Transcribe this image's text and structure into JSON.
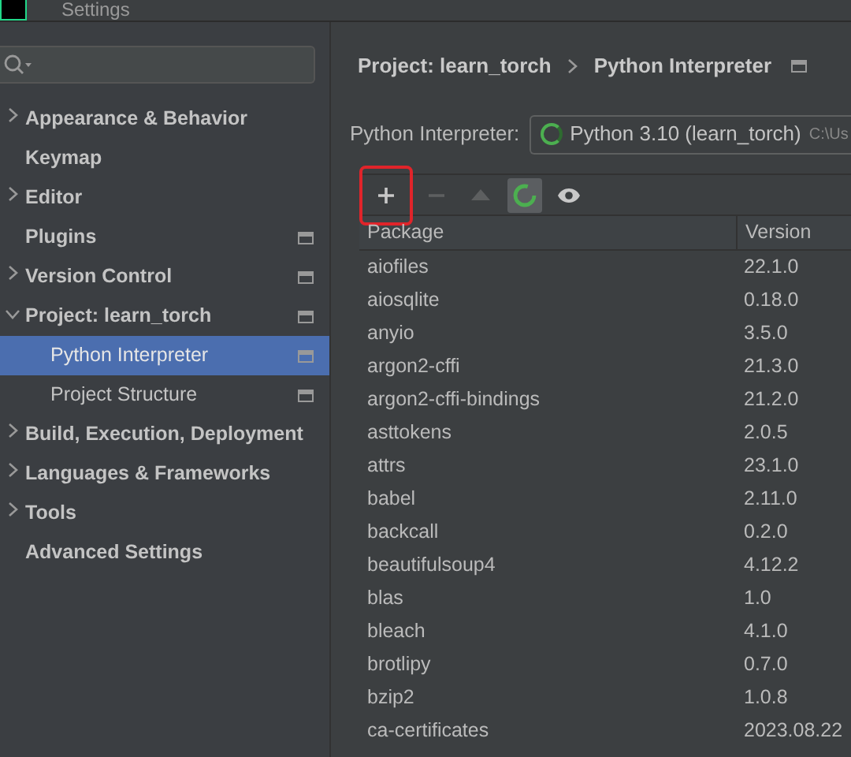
{
  "window": {
    "title": "Settings"
  },
  "sidebar": {
    "items": [
      {
        "label": "Appearance & Behavior",
        "expandable": true,
        "expanded": false,
        "project_mark": false,
        "selected": false
      },
      {
        "label": "Keymap",
        "expandable": false,
        "project_mark": false,
        "selected": false
      },
      {
        "label": "Editor",
        "expandable": true,
        "expanded": false,
        "project_mark": false,
        "selected": false
      },
      {
        "label": "Plugins",
        "expandable": false,
        "project_mark": true,
        "selected": false
      },
      {
        "label": "Version Control",
        "expandable": true,
        "expanded": false,
        "project_mark": true,
        "selected": false
      },
      {
        "label": "Project: learn_torch",
        "expandable": true,
        "expanded": true,
        "project_mark": true,
        "selected": false,
        "children": [
          {
            "label": "Python Interpreter",
            "project_mark": true,
            "selected": true
          },
          {
            "label": "Project Structure",
            "project_mark": true,
            "selected": false
          }
        ]
      },
      {
        "label": "Build, Execution, Deployment",
        "expandable": true,
        "expanded": false,
        "project_mark": false,
        "selected": false
      },
      {
        "label": "Languages & Frameworks",
        "expandable": true,
        "expanded": false,
        "project_mark": false,
        "selected": false
      },
      {
        "label": "Tools",
        "expandable": true,
        "expanded": false,
        "project_mark": false,
        "selected": false
      },
      {
        "label": "Advanced Settings",
        "expandable": false,
        "project_mark": false,
        "selected": false
      }
    ]
  },
  "breadcrumb": {
    "parts": [
      "Project: learn_torch",
      "Python Interpreter"
    ],
    "project_mark": true
  },
  "interpreter": {
    "label": "Python Interpreter:",
    "value": "Python 3.10 (learn_torch)",
    "path": "C:\\Us"
  },
  "toolbar": [
    {
      "kind": "add",
      "disabled": false,
      "active": false,
      "highlighted": true
    },
    {
      "kind": "remove",
      "disabled": true,
      "active": false,
      "highlighted": false
    },
    {
      "kind": "upgrade",
      "disabled": true,
      "active": false,
      "highlighted": false
    },
    {
      "kind": "refresh",
      "disabled": false,
      "active": true,
      "highlighted": false
    },
    {
      "kind": "show",
      "disabled": false,
      "active": false,
      "highlighted": false
    }
  ],
  "table": {
    "columns": [
      "Package",
      "Version"
    ],
    "rows": [
      [
        "aiofiles",
        "22.1.0"
      ],
      [
        "aiosqlite",
        "0.18.0"
      ],
      [
        "anyio",
        "3.5.0"
      ],
      [
        "argon2-cffi",
        "21.3.0"
      ],
      [
        "argon2-cffi-bindings",
        "21.2.0"
      ],
      [
        "asttokens",
        "2.0.5"
      ],
      [
        "attrs",
        "23.1.0"
      ],
      [
        "babel",
        "2.11.0"
      ],
      [
        "backcall",
        "0.2.0"
      ],
      [
        "beautifulsoup4",
        "4.12.2"
      ],
      [
        "blas",
        "1.0"
      ],
      [
        "bleach",
        "4.1.0"
      ],
      [
        "brotlipy",
        "0.7.0"
      ],
      [
        "bzip2",
        "1.0.8"
      ],
      [
        "ca-certificates",
        "2023.08.22"
      ]
    ]
  }
}
